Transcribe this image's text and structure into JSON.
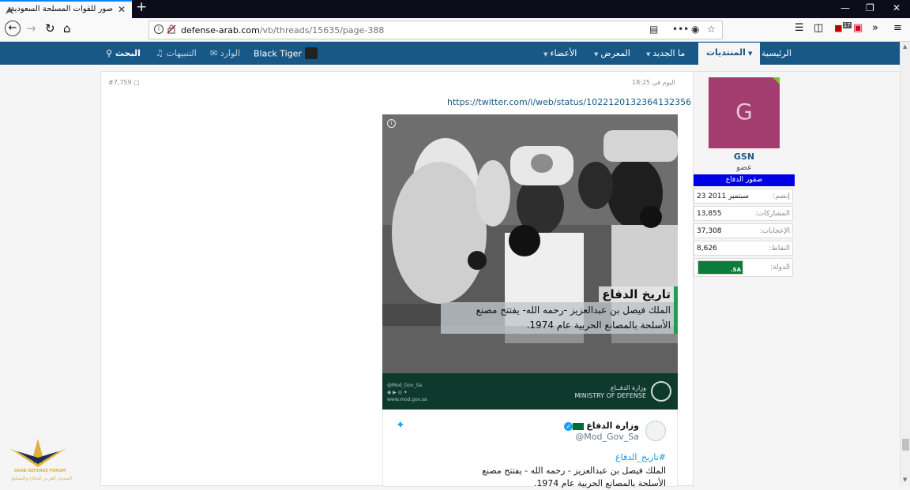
{
  "browser": {
    "tab_title": "صور للقوات المسلحة السعودية",
    "tab_close": "✕",
    "new_tab": "+",
    "url_domain": "defense-arab.com",
    "url_path": "/vb/threads/15635/page-388",
    "url_dots": "•••",
    "notification_count": "17"
  },
  "site_nav": {
    "home": "الرئيسية",
    "forums": "المنتديات",
    "whats_new": "ما الجديد",
    "gallery": "المعرض",
    "members": "الأعضاء",
    "username": "Black Tiger",
    "inbox": "الوارد",
    "alerts": "التنبيهات",
    "search": "البحث"
  },
  "post": {
    "number": "#7,759",
    "time": "اليوم في 18:25",
    "tweet_link": "https://twitter.com/i/web/status/1022120132364132356",
    "image": {
      "caption_heading": "تاريخ الدفاع",
      "caption_body": "الملك فيصل بن عبدالعزيز -رحمه الله- يفتتح مصنع الأسلحة بالمصانع الحربية عام 1974.",
      "footer_handle": "@Mod_Gov_Sa",
      "footer_site": "www.mod.gov.sa",
      "footer_ministry_ar": "وزارة الدفــاع",
      "footer_ministry_en": "MINISTRY OF DEFENSE"
    },
    "embed": {
      "account_name": "وزارة الدفاع",
      "verified_mark": "✓",
      "screen_name": "@Mod_Gov_Sa",
      "hashtag": "#تاريخ_الدفاع",
      "text": "الملك فيصل بن عبدالعزيز - رحمه الله - يفتتح مصنع الأسلحة بالمصانع الحربية عام 1974."
    }
  },
  "user": {
    "avatar_letter": "G",
    "name": "GSN",
    "title": "عضو",
    "banner": "صقور الدفاع",
    "joined_label": "إنضم:",
    "joined_value": "23 سبتمبر 2011",
    "posts_label": "المشاركات:",
    "posts_value": "13,855",
    "likes_label": "الإعجابات:",
    "likes_value": "37,308",
    "points_label": "النقاط:",
    "points_value": "8,626",
    "country_label": "الدولة:",
    "country_code": ".SA"
  },
  "site_logo": {
    "line1": "ARAB DEFENSE FORUM",
    "line2": "المنتدى العربي للدفاع والتسليح"
  }
}
